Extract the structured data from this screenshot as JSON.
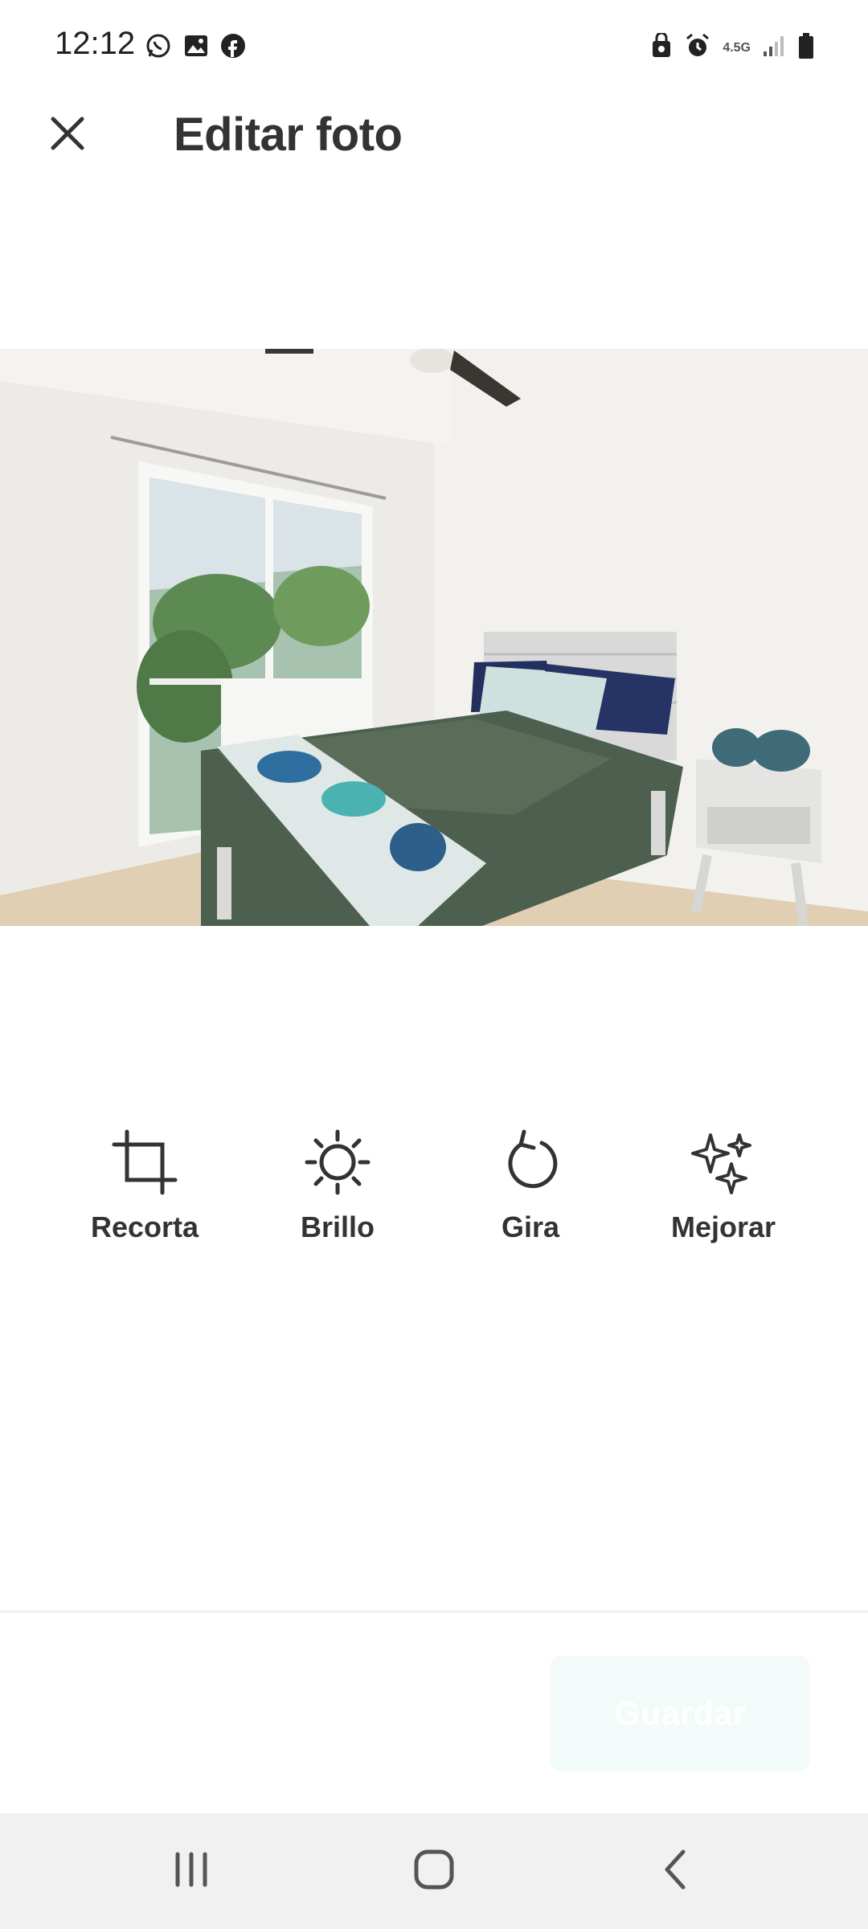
{
  "status": {
    "time": "12:12",
    "network_label": "4.5G",
    "left_icons": [
      "whatsapp-icon",
      "gallery-icon",
      "facebook-icon"
    ],
    "right_icons": [
      "recycle-lock-icon",
      "alarm-icon",
      "signal-icon",
      "battery-icon"
    ]
  },
  "header": {
    "title": "Editar foto",
    "close_icon": "close-icon"
  },
  "photo": {
    "description_icon": "photo-preview"
  },
  "tools": [
    {
      "label": "Recorta",
      "icon": "crop-icon"
    },
    {
      "label": "Brillo",
      "icon": "brightness-icon"
    },
    {
      "label": "Gira",
      "icon": "rotate-icon"
    },
    {
      "label": "Mejorar",
      "icon": "sparkles-icon"
    }
  ],
  "footer": {
    "save_label": "Guardar"
  },
  "colors": {
    "text": "#333333",
    "save_bg": "#f3fbfa",
    "navbar_bg": "#f1f1f1"
  },
  "navbar": {
    "icons": [
      "recent-apps-icon",
      "home-icon",
      "back-icon"
    ]
  }
}
